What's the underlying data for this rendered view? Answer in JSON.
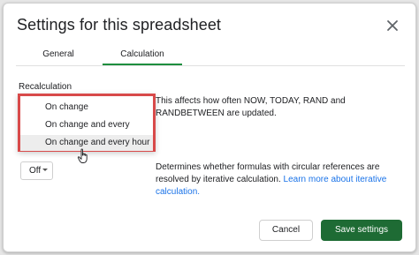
{
  "dialog": {
    "title": "Settings for this spreadsheet",
    "close_icon": "close-icon"
  },
  "tabs": [
    {
      "label": "General",
      "active": false
    },
    {
      "label": "Calculation",
      "active": true
    }
  ],
  "recalculation": {
    "label": "Recalculation",
    "description": "This affects how often NOW, TODAY, RAND and RANDBETWEEN are updated.",
    "options": [
      {
        "label": "On change"
      },
      {
        "label": "On change and every minute"
      },
      {
        "label": "On change and every hour",
        "hovered": true
      }
    ]
  },
  "iterative": {
    "value": "Off",
    "description": "Determines whether formulas with circular references are resolved by iterative calculation.",
    "link_text": "Learn more about iterative calculation."
  },
  "footer": {
    "cancel_label": "Cancel",
    "save_label": "Save settings"
  },
  "colors": {
    "accent": "#1e6b34",
    "tab_underline": "#1e8e3e",
    "highlight_box": "#d84a4a",
    "link": "#1a73e8"
  }
}
